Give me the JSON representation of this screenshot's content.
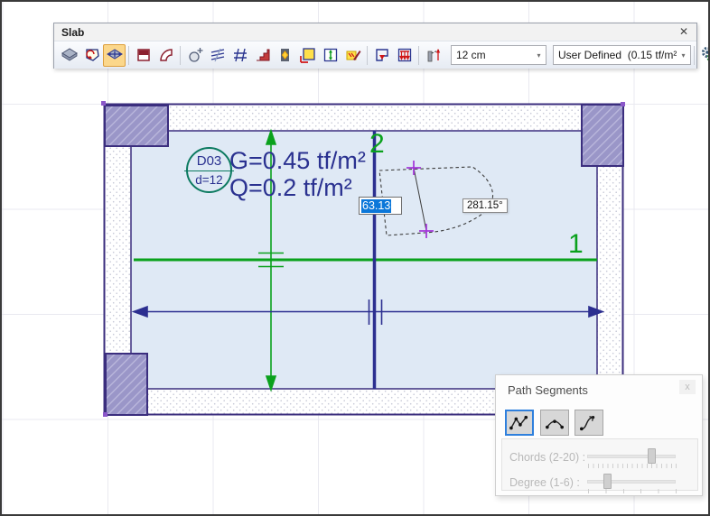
{
  "window": {
    "title": "Slab"
  },
  "toolbar": {
    "thickness_combo": "12 cm",
    "load_combo": "User Defined  (0.15 tf/m²)"
  },
  "canvas": {
    "slab_id": "D03",
    "slab_thickness": "d=12",
    "dead_load": "G=0.45 tf/m²",
    "live_load": "Q=0.2 tf/m²",
    "axis1": "1",
    "axis2": "2",
    "length_field": "63.13",
    "angle_tooltip": "281.15°"
  },
  "path_segments": {
    "title": "Path Segments",
    "chords_label": "Chords (2-20) :",
    "degree_label": "Degree (1-6) :"
  },
  "icons": {
    "window_close": "✕",
    "panel_close": "x",
    "combo_arrow": "▾"
  },
  "colors": {
    "axis_green": "#0aa11c",
    "dimension_navy": "#2c2f90",
    "slab_fill": "#dfe9f5",
    "outline_purple": "#3b2e7e",
    "column_fill": "#9a96c8",
    "selection_blue": "#0b77d9",
    "selected_tool_bg": "#fbd78b",
    "cross_purple": "#a233d9"
  }
}
